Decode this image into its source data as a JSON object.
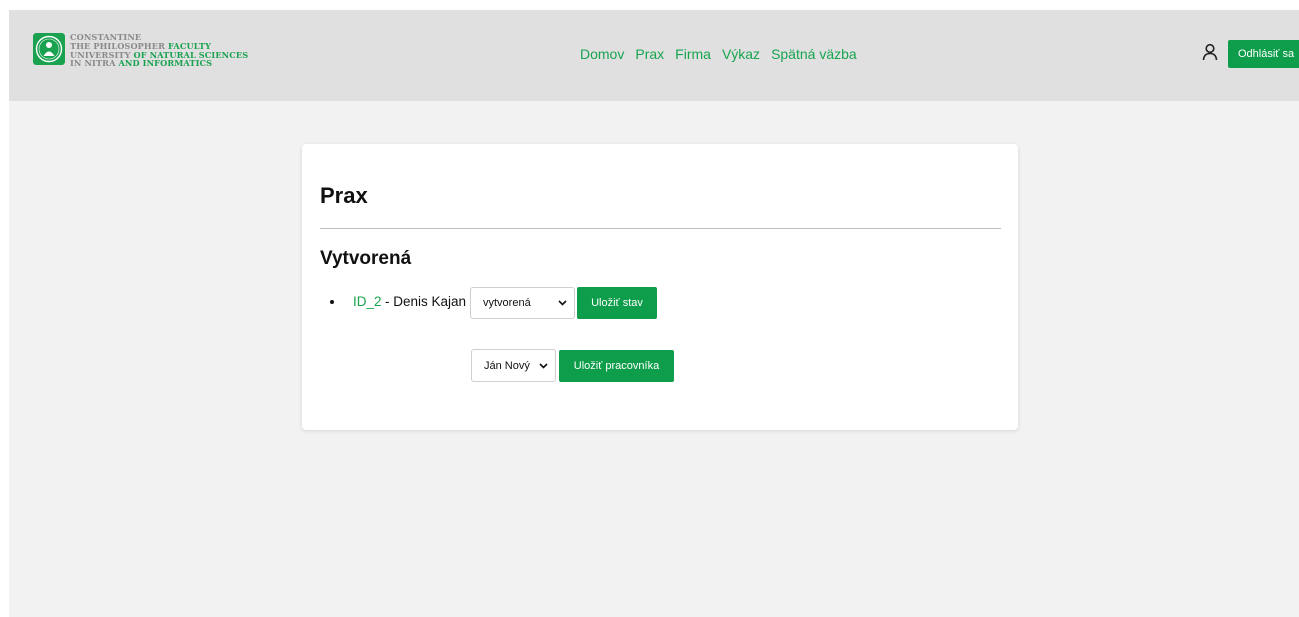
{
  "header": {
    "logo": {
      "line1": "CONSTANTINE",
      "line2_a": "THE PHILOSOPHER ",
      "line2_b": "FACULTY",
      "line3_a": "UNIVERSITY ",
      "line3_b": "OF NATURAL SCIENCES",
      "line4_a": "IN NITRA ",
      "line4_b": "AND INFORMATICS"
    },
    "nav": [
      {
        "label": "Domov"
      },
      {
        "label": "Prax"
      },
      {
        "label": "Firma"
      },
      {
        "label": "Výkaz"
      },
      {
        "label": "Spätná väzba"
      }
    ],
    "user_icon": "user-icon",
    "logout_label": "Odhlásiť sa"
  },
  "main": {
    "title": "Prax",
    "section_title": "Vytvorená",
    "entry": {
      "id_link": "ID_2",
      "name": "- Denis Kajan",
      "status_value": "vytvorená",
      "save_status_label": "Uložiť stav",
      "worker_value": "Ján Nový",
      "save_worker_label": "Uložiť pracovníka"
    }
  },
  "colors": {
    "accent": "#0e9d4a",
    "link": "#17a44f",
    "header_bg": "#e0e0e0",
    "page_bg": "#f2f2f2"
  }
}
